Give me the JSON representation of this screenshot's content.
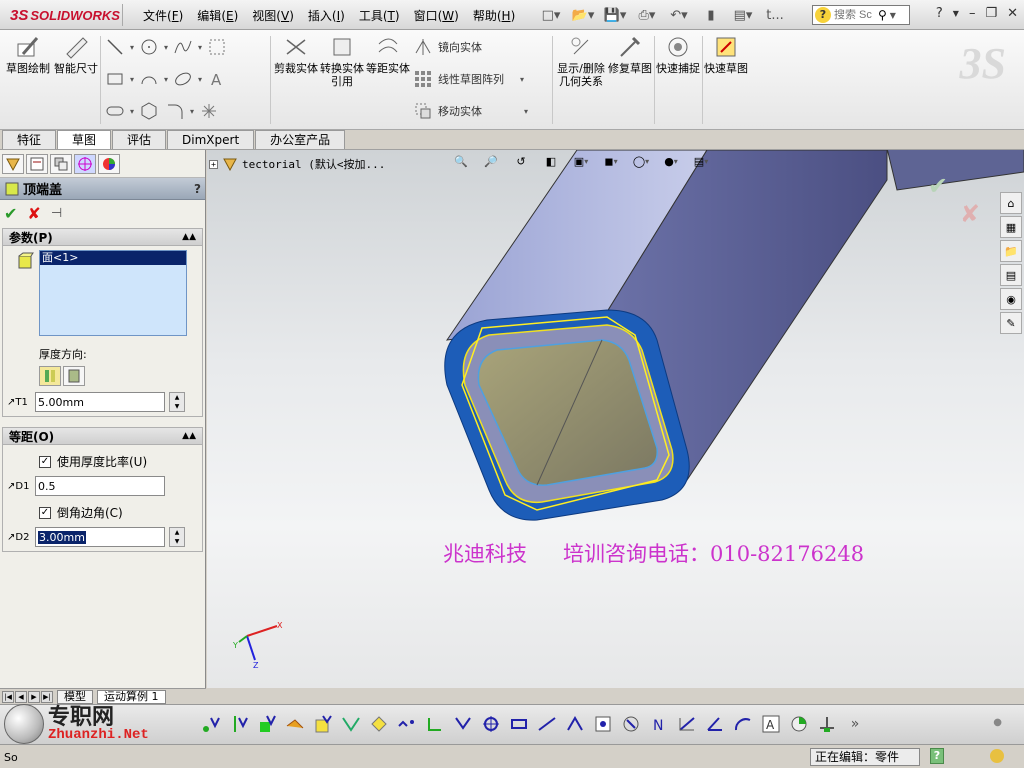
{
  "app": {
    "logo_ds": "3S",
    "logo_name": "SOLIDWORKS"
  },
  "menu": {
    "items": [
      {
        "label": "文件",
        "key": "F"
      },
      {
        "label": "编辑",
        "key": "E"
      },
      {
        "label": "视图",
        "key": "V"
      },
      {
        "label": "插入",
        "key": "I"
      },
      {
        "label": "工具",
        "key": "T"
      },
      {
        "label": "窗口",
        "key": "W"
      },
      {
        "label": "帮助",
        "key": "H"
      }
    ],
    "qa_extra": "t..."
  },
  "search": {
    "placeholder": "搜索 Sc"
  },
  "ribbon": {
    "sketch": "草图绘制",
    "smart_dim": "智能尺寸",
    "trim": "剪裁实体",
    "convert": "转换实体引用",
    "offset": "等距实体",
    "mirror": "镜向实体",
    "linear_pattern": "线性草图阵列",
    "move": "移动实体",
    "display_relations": "显示/删除几何关系",
    "repair": "修复草图",
    "quick_snaps": "快速捕捉",
    "rapid_sketch": "快速草图"
  },
  "tabs": [
    {
      "label": "特征",
      "active": false
    },
    {
      "label": "草图",
      "active": true
    },
    {
      "label": "评估",
      "active": false
    },
    {
      "label": "DimXpert",
      "active": false
    },
    {
      "label": "办公室产品",
      "active": false
    }
  ],
  "property_manager": {
    "title": "顶端盖",
    "help": "?",
    "parameters": {
      "title": "参数(P)",
      "selection": "面<1>",
      "direction_label": "厚度方向:",
      "thickness": "5.00mm"
    },
    "offset": {
      "title": "等距(O)",
      "use_ratio_label": "使用厚度比率(U)",
      "ratio": "0.5",
      "chamfer_label": "倒角边角(C)",
      "chamfer": "3.00mm"
    }
  },
  "graphics": {
    "tree_root": "tectorial  (默认<按加...",
    "watermark_company": "兆迪科技",
    "watermark_phone": "培训咨询电话：010-82176248"
  },
  "bottom_tabs": [
    {
      "label": "模型",
      "active": false
    },
    {
      "label": "运动算例 1",
      "active": true
    }
  ],
  "status": {
    "left": "So",
    "right": "正在编辑：零件",
    "help": "?"
  },
  "site": {
    "cn": "专职网",
    "en": "Zhuanzhi.Net"
  },
  "colors": {
    "brand_red": "#c8102e",
    "watermark_magenta": "#cc33cc",
    "selection_blue": "#0a246a"
  }
}
